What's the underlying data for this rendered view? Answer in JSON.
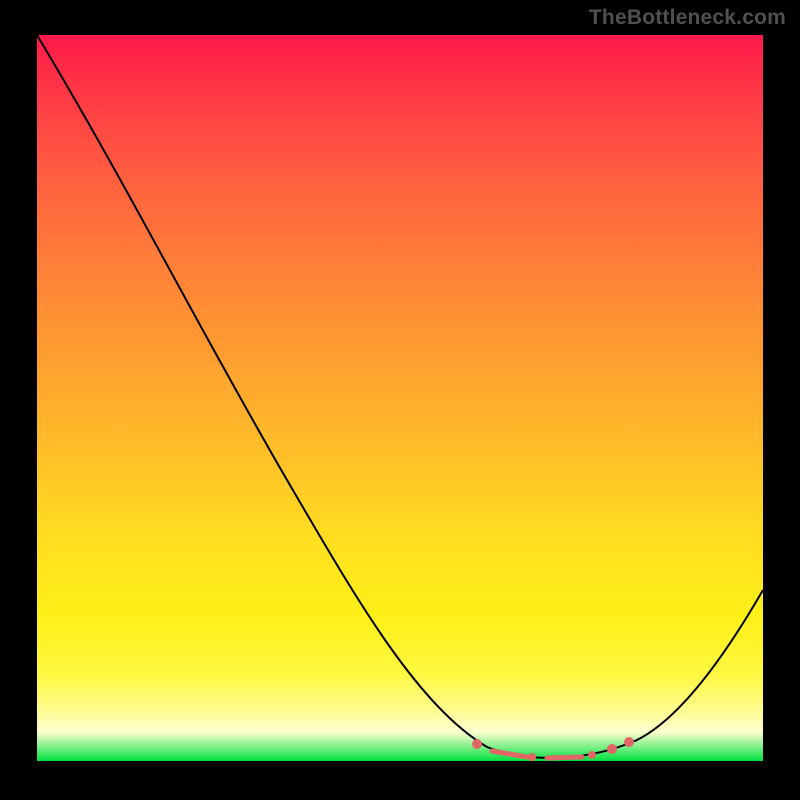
{
  "watermark": "TheBottleneck.com",
  "chart_data": {
    "type": "line",
    "title": "",
    "xlabel": "",
    "ylabel": "",
    "x": [
      0,
      0.1,
      0.2,
      0.3,
      0.4,
      0.5,
      0.6,
      0.65,
      0.7,
      0.75,
      0.8,
      0.85,
      0.9,
      0.95,
      1.0
    ],
    "series": [
      {
        "name": "bottleneck-curve",
        "values": [
          100,
          86,
          72,
          58,
          44,
          30,
          14,
          6,
          2,
          0,
          0,
          3,
          8,
          16,
          24
        ]
      }
    ],
    "optimal_range_x": [
      0.6,
      0.82
    ],
    "ylim": [
      0,
      100
    ],
    "background_gradient": {
      "top": "#ff1a4a",
      "mid": "#ffe020",
      "bottom": "#00e040"
    },
    "highlighted_points_x": [
      0.605,
      0.68,
      0.76,
      0.79,
      0.815
    ],
    "annotations": []
  }
}
